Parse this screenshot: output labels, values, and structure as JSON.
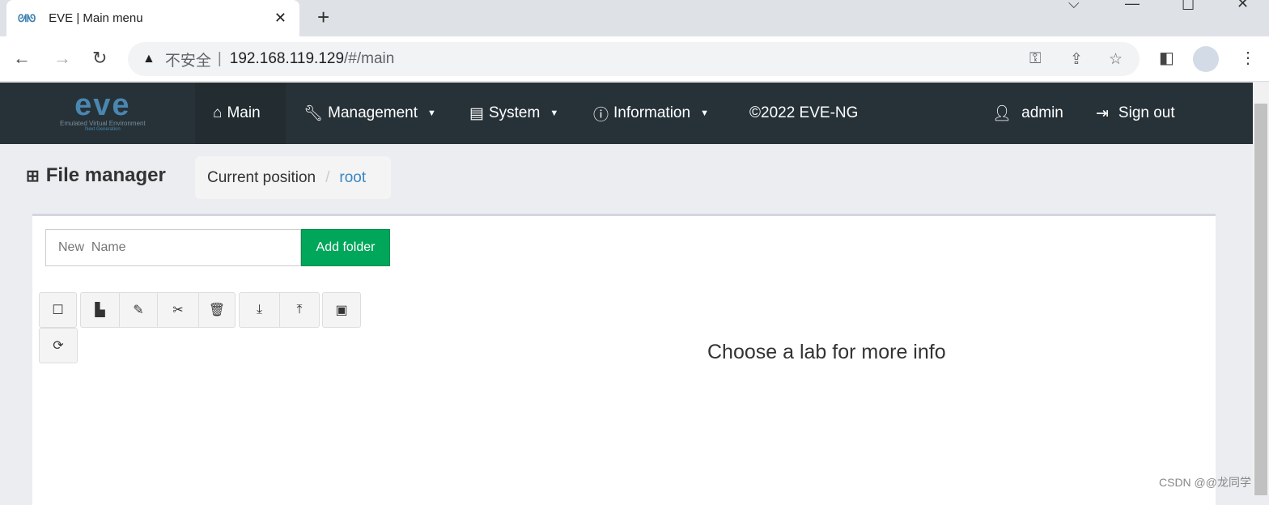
{
  "browser": {
    "tab_title": "EVE | Main menu",
    "security_label": "不安全",
    "url_host": "192.168.119.129",
    "url_path": "/#/main"
  },
  "nav": {
    "logo_text": "eve",
    "logo_sub1": "Emulated Virtual Environment",
    "logo_sub2": "Next Generation",
    "items": [
      {
        "label": "Main"
      },
      {
        "label": "Management"
      },
      {
        "label": "System"
      },
      {
        "label": "Information"
      },
      {
        "label": "©2022 EVE-NG"
      }
    ],
    "user": "admin",
    "signout": "Sign out"
  },
  "page": {
    "title": "File manager",
    "breadcrumb_label": "Current position",
    "breadcrumb_root": "root"
  },
  "form": {
    "placeholder": "New  Name",
    "add_folder": "Add folder"
  },
  "main": {
    "info_text": "Choose a lab for more info"
  },
  "watermark": "CSDN @@龙同学",
  "colors": {
    "navbar": "#263238",
    "accent_green": "#00a65a",
    "link": "#3a87c2"
  }
}
